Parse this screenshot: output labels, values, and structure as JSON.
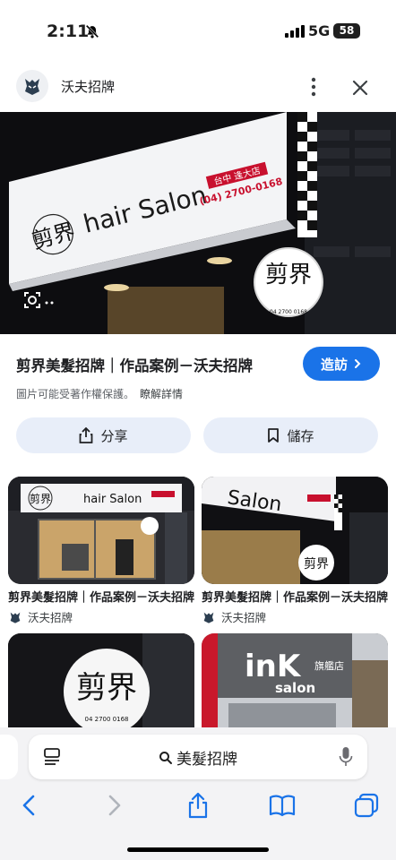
{
  "status": {
    "time": "2:11",
    "network": "5G",
    "battery": "58",
    "icon_bell": "bell-slash-icon"
  },
  "header": {
    "site_name": "沃夫招牌"
  },
  "hero": {
    "sign_text": "hair Salon",
    "brand_char": "剪界",
    "branch": "台中 逢大店",
    "phone": "(04) 2700-0168",
    "round_sign_phone": "04 2700 0168"
  },
  "result": {
    "title": "剪界美髮招牌｜作品案例－沃夫招牌",
    "visit_label": "造訪",
    "copyright": "圖片可能受著作權保護。",
    "learn_more": "瞭解詳情"
  },
  "actions": {
    "share_label": "分享",
    "save_label": "儲存"
  },
  "related": [
    {
      "title": "剪界美髮招牌｜作品案例－沃夫招牌",
      "source": "沃夫招牌"
    },
    {
      "title": "剪界美髮招牌｜作品案例－沃夫招牌",
      "source": "沃夫招牌"
    }
  ],
  "thumb_texts": {
    "salon": "hair Salon",
    "salon2": "Salon",
    "ink": "inK",
    "ink_sub": "旗艦店",
    "salon3": "salon",
    "brand": "剪界",
    "phone": "04 2700 0168"
  },
  "browser": {
    "address": "美髮招牌"
  },
  "colors": {
    "accent": "#1a73e8",
    "chip_bg": "#e8eef9"
  }
}
